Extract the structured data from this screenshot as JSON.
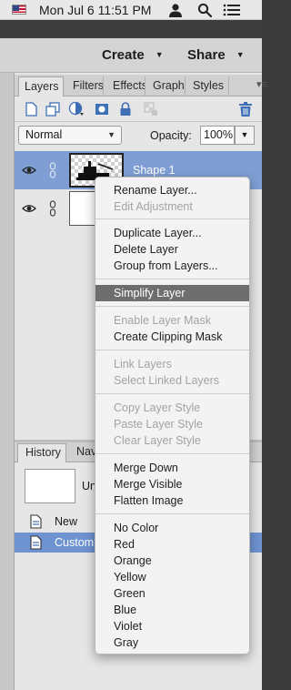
{
  "menubar": {
    "clock": "Mon Jul 6  11:51 PM",
    "icons": [
      "flag-icon",
      "user-icon",
      "search-icon",
      "list-menu-icon"
    ]
  },
  "header": {
    "create_label": "Create",
    "share_label": "Share"
  },
  "layers_panel": {
    "tabs": [
      {
        "label": "Layers"
      },
      {
        "label": "Filters"
      },
      {
        "label": "Effects"
      },
      {
        "label": "Graphics"
      },
      {
        "label": "Styles"
      }
    ],
    "blend_mode": "Normal",
    "opacity_label": "Opacity:",
    "opacity_value": "100%",
    "layers": [
      {
        "name": "Shape 1",
        "selected": true
      },
      {
        "name": "",
        "selected": false
      }
    ]
  },
  "history_panel": {
    "tabs": [
      {
        "label": "History"
      },
      {
        "label": "Navigator"
      }
    ],
    "document_label": "Untitled",
    "items": [
      {
        "label": "New"
      },
      {
        "label": "Custom Shape"
      }
    ]
  },
  "context_menu": {
    "items": [
      {
        "label": "Rename Layer...",
        "disabled": false
      },
      {
        "label": "Edit Adjustment",
        "disabled": true
      },
      {
        "label": "Duplicate Layer...",
        "disabled": false
      },
      {
        "label": "Delete Layer",
        "disabled": false
      },
      {
        "label": "Group from Layers...",
        "disabled": false
      },
      {
        "label": "Simplify Layer",
        "disabled": false,
        "highlighted": true
      },
      {
        "label": "Enable Layer Mask",
        "disabled": true
      },
      {
        "label": "Create Clipping Mask",
        "disabled": false
      },
      {
        "label": "Link Layers",
        "disabled": true
      },
      {
        "label": "Select Linked Layers",
        "disabled": true
      },
      {
        "label": "Copy Layer Style",
        "disabled": true
      },
      {
        "label": "Paste Layer Style",
        "disabled": true
      },
      {
        "label": "Clear Layer Style",
        "disabled": true
      },
      {
        "label": "Merge Down",
        "disabled": false
      },
      {
        "label": "Merge Visible",
        "disabled": false
      },
      {
        "label": "Flatten Image",
        "disabled": false
      },
      {
        "label": "No Color",
        "disabled": false
      },
      {
        "label": "Red",
        "disabled": false
      },
      {
        "label": "Orange",
        "disabled": false
      },
      {
        "label": "Yellow",
        "disabled": false
      },
      {
        "label": "Green",
        "disabled": false
      },
      {
        "label": "Blue",
        "disabled": false
      },
      {
        "label": "Violet",
        "disabled": false
      },
      {
        "label": "Gray",
        "disabled": false
      }
    ]
  },
  "colors": {
    "selected_layer": "#7f9ed3",
    "selected_history": "#6f93d1",
    "menu_highlight": "#6e6e6e"
  }
}
